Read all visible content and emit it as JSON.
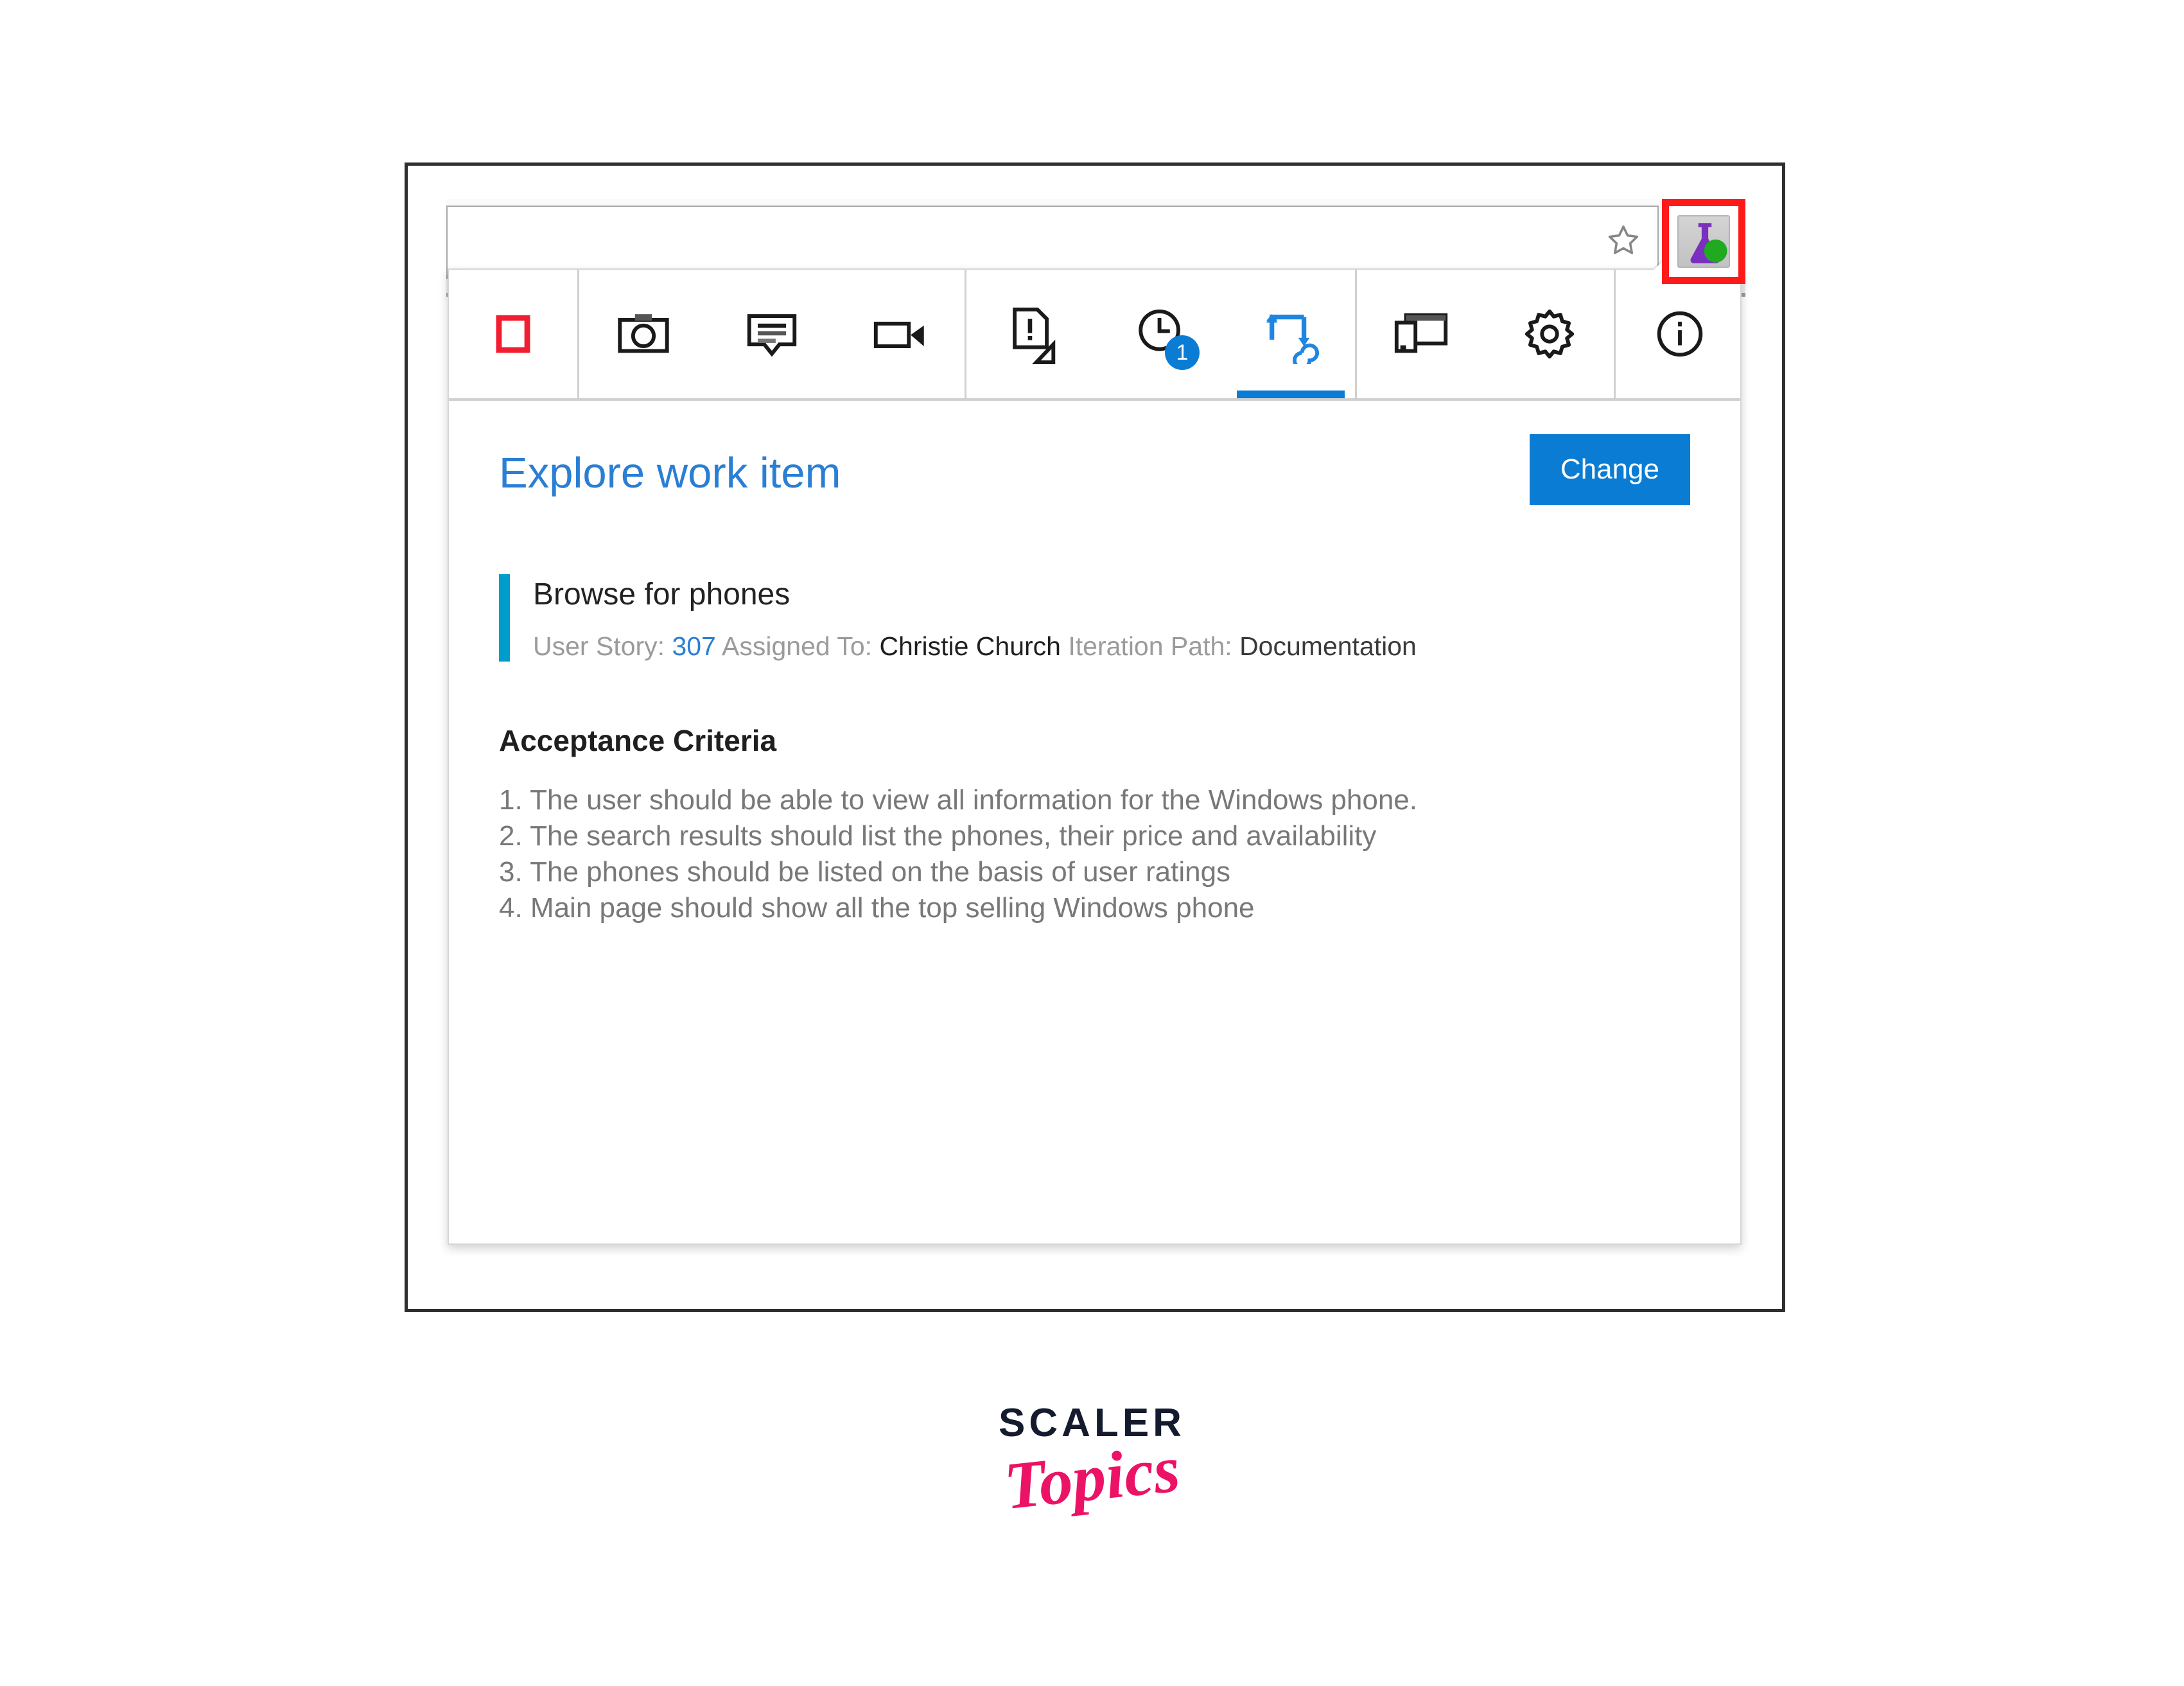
{
  "browser": {
    "address_value": "",
    "address_placeholder": "",
    "bookmark_icon": "star-icon",
    "extension_icon": "flask-icon",
    "extension_highlight_color": "#ff1a1a"
  },
  "toolbar": {
    "items": [
      {
        "name": "stop-recording",
        "icon": "red-square-icon",
        "selected": false,
        "badge": null
      },
      {
        "name": "capture-screenshot",
        "icon": "camera-icon",
        "selected": false,
        "badge": null
      },
      {
        "name": "add-note",
        "icon": "comment-icon",
        "selected": false,
        "badge": null
      },
      {
        "name": "record-screen",
        "icon": "video-camera-icon",
        "selected": false,
        "badge": null
      },
      {
        "name": "create-bug",
        "icon": "bug-report-icon",
        "selected": false,
        "badge": null
      },
      {
        "name": "session-timeline",
        "icon": "clock-icon",
        "selected": false,
        "badge": "1"
      },
      {
        "name": "explore-work-item",
        "icon": "explore-sync-icon",
        "selected": true,
        "badge": null
      },
      {
        "name": "device-emulation",
        "icon": "monitor-icon",
        "selected": false,
        "badge": null
      },
      {
        "name": "settings",
        "icon": "gear-icon",
        "selected": false,
        "badge": null
      },
      {
        "name": "info",
        "icon": "info-icon",
        "selected": false,
        "badge": null
      }
    ]
  },
  "main": {
    "title": "Explore work item",
    "change_button_label": "Change",
    "work_item": {
      "title": "Browse for phones",
      "type_label": "User Story:",
      "id": "307",
      "assigned_label": "Assigned To:",
      "assigned_value": "Christie Church",
      "iteration_label": "Iteration Path:",
      "iteration_value": "Documentation"
    },
    "acceptance_heading": "Acceptance Criteria",
    "acceptance_criteria": [
      "1. The user should be able to view all information for the Windows phone.",
      "2. The search results should list the phones, their price and availability",
      "3. The phones should be listed on the basis of user ratings",
      "4. Main page should show all the top selling Windows phone"
    ]
  },
  "branding": {
    "name": "SCALER",
    "sub": "Topics",
    "name_color": "#141b2e",
    "sub_color": "#ec1265"
  },
  "colors": {
    "accent_blue": "#0a7cd4",
    "title_blue": "#2a7fd4",
    "workitem_bar": "#009ccc",
    "highlight_red": "#ff1a1a"
  }
}
